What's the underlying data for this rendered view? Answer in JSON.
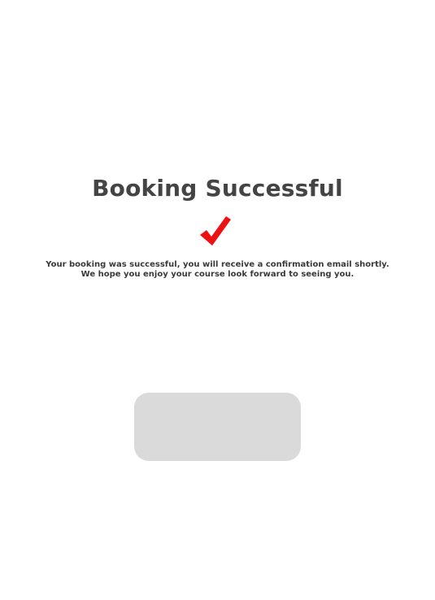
{
  "confirmation": {
    "title": "Booking Successful",
    "check_icon": "checkmark-icon",
    "accent_color": "#ee1111",
    "message_line_1": "Your booking was successful, you will receive a confirmation email shortly.",
    "message_line_2": "We hope you enjoy your course look forward to seeing you."
  }
}
